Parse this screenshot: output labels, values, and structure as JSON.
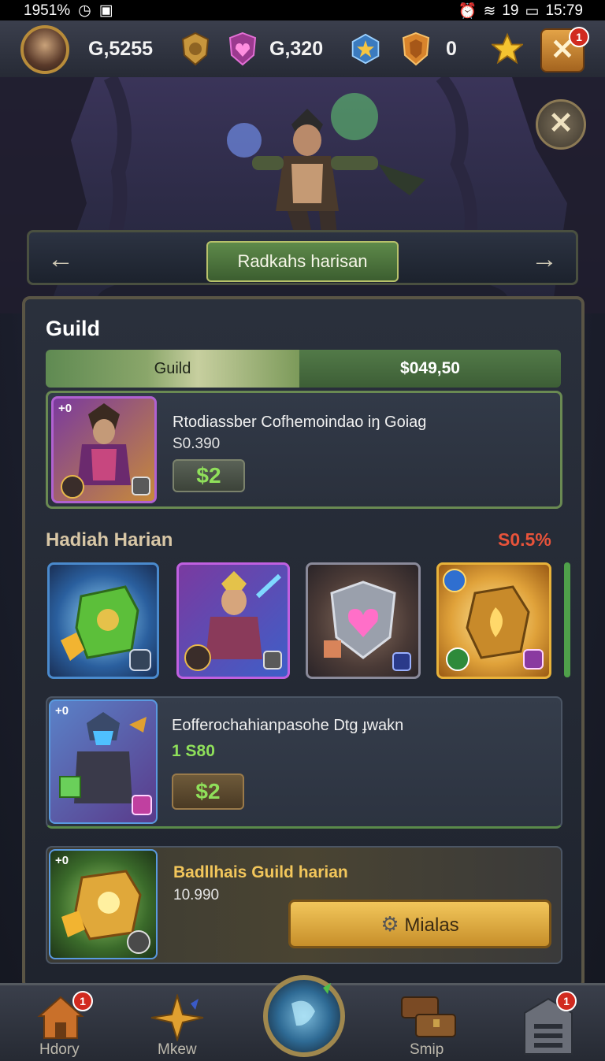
{
  "status_bar": {
    "left_text": "1951%",
    "time": "15:79",
    "signal_text": "19"
  },
  "resources": {
    "gold": "G,5255",
    "gems": "G,320",
    "tokens": "0",
    "close_badge": "1"
  },
  "hero": {
    "title": "Radkahs harisan",
    "prev_arrow": "←",
    "next_arrow": "→"
  },
  "guild": {
    "section_title": "Guild",
    "tab_left": "Guild",
    "tab_right": "$049,50",
    "featured": {
      "name": "Rtodiassber Cofhemoindao iŋ Goiag",
      "sub": "S0.390",
      "price": "$2",
      "badge": "+0"
    }
  },
  "daily": {
    "title": "Hadiah Harian",
    "percent": "S0.5%",
    "items": [
      {
        "name": "green-crate"
      },
      {
        "name": "purple-warrior"
      },
      {
        "name": "heart-shield"
      },
      {
        "name": "gold-rune"
      }
    ]
  },
  "offer2": {
    "name": "Eofferochahianpasohe Dtg ɟwakn",
    "sub": "1 S80",
    "price": "$2",
    "badge": "+0"
  },
  "offer3": {
    "name": "Badllhais Guild harian",
    "sub": "10.990",
    "button": "Mialas",
    "badge": "+0"
  },
  "bottom_nav": {
    "items": [
      {
        "label": "Hdory",
        "badge": "1"
      },
      {
        "label": "Mkew",
        "badge": ""
      },
      {
        "label": "",
        "badge": ""
      },
      {
        "label": "Smip",
        "badge": ""
      },
      {
        "label": "",
        "badge": "1"
      }
    ]
  },
  "colors": {
    "accent_green": "#5e8a4a",
    "price_green": "#8fe05a",
    "alert_red": "#e8533a",
    "gold": "#f2c65b"
  }
}
